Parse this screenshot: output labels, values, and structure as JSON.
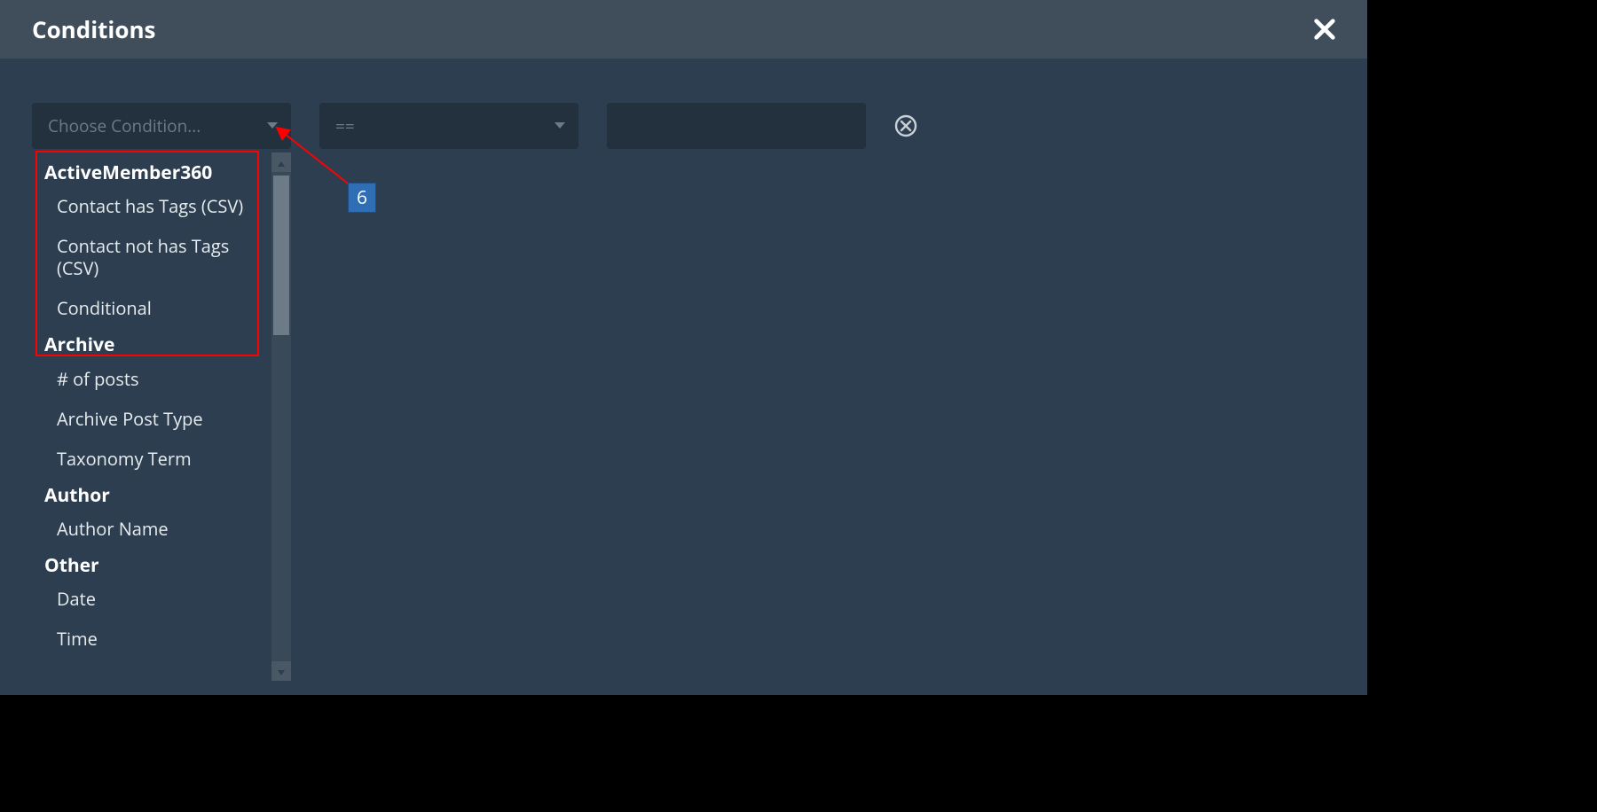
{
  "header": {
    "title": "Conditions"
  },
  "row": {
    "condition_placeholder": "Choose Condition...",
    "operator_value": "=="
  },
  "annotation": {
    "badge": "6"
  },
  "dropdown": {
    "groups": [
      {
        "title": "ActiveMember360",
        "options": [
          "Contact has Tags (CSV)",
          "Contact not has Tags (CSV)",
          "Conditional"
        ]
      },
      {
        "title": "Archive",
        "options": [
          "# of posts",
          "Archive Post Type",
          "Taxonomy Term"
        ]
      },
      {
        "title": "Author",
        "options": [
          "Author Name"
        ]
      },
      {
        "title": "Other",
        "options": [
          "Date",
          "Time"
        ]
      }
    ]
  }
}
